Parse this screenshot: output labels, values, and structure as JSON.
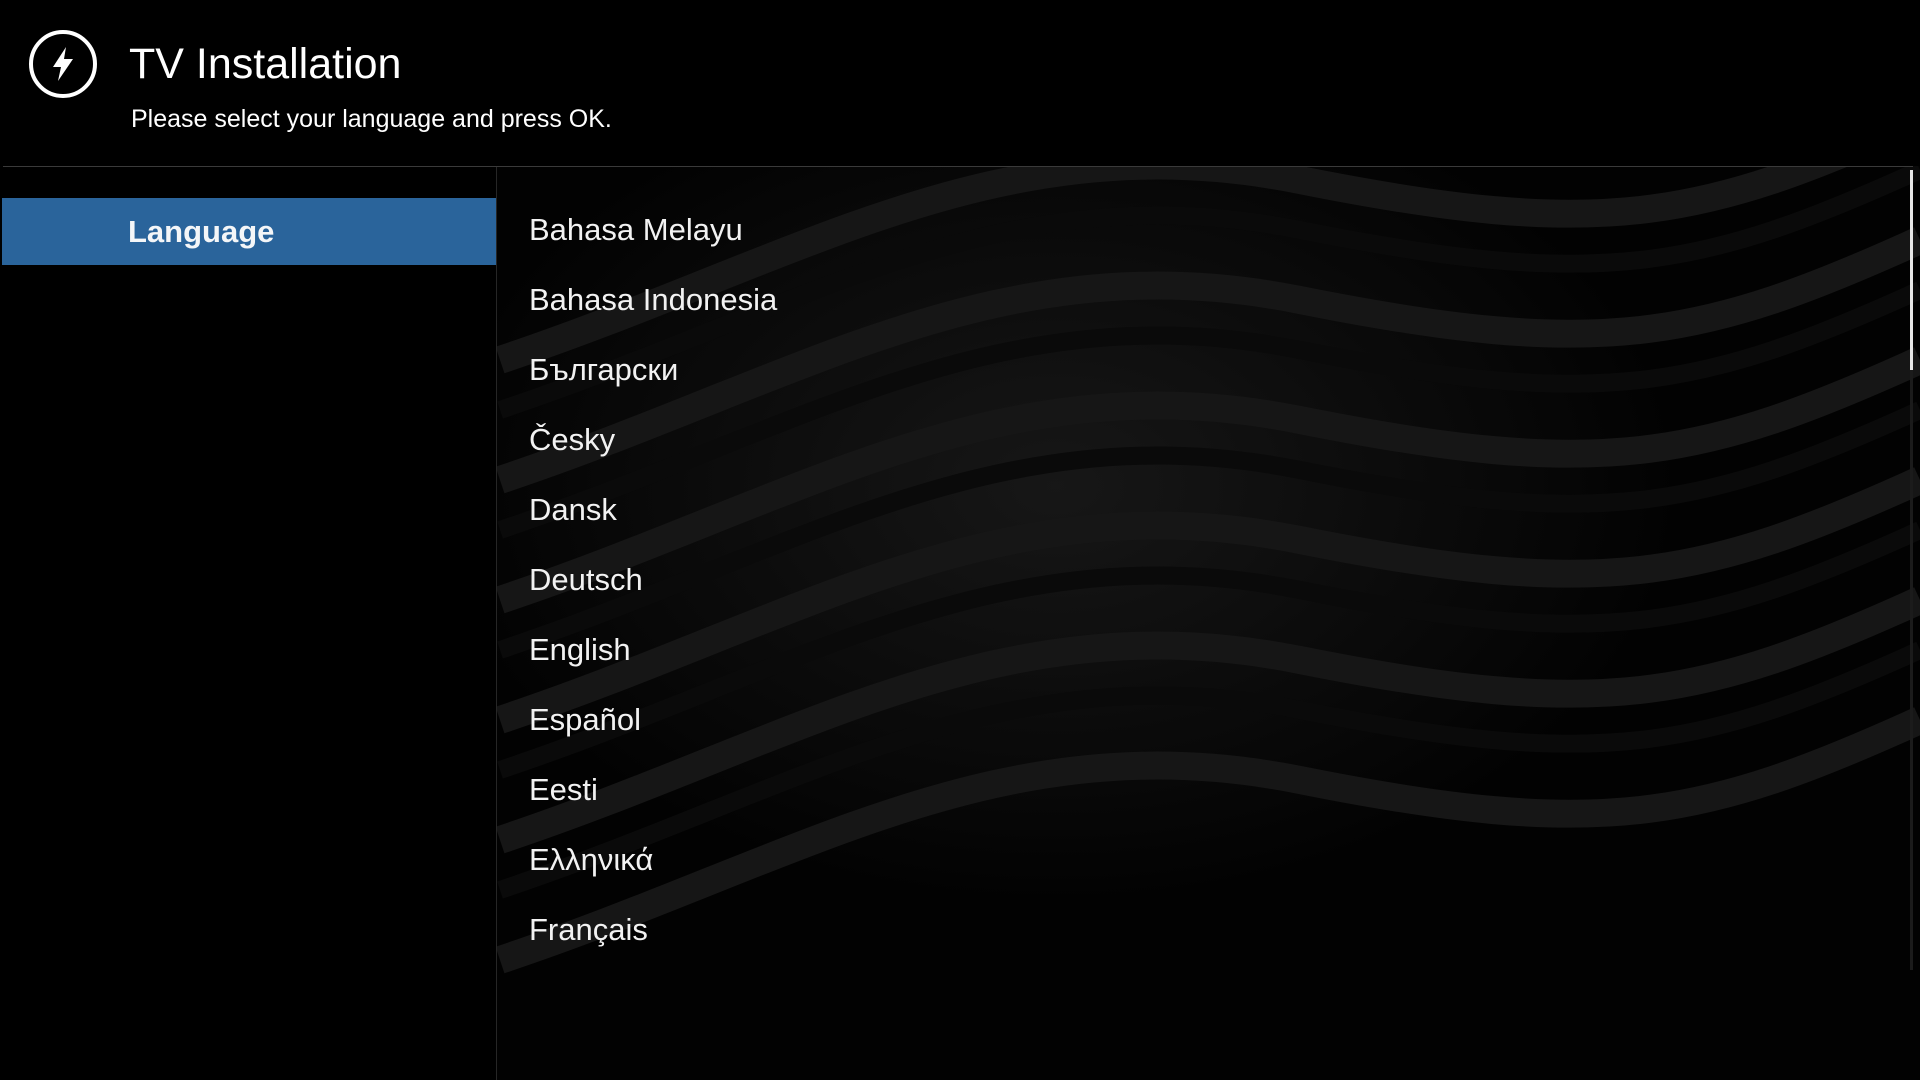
{
  "header": {
    "icon": "lightning-bolt-icon",
    "title": "TV Installation",
    "subtitle": "Please select your language and press OK."
  },
  "sidebar": {
    "items": [
      {
        "label": "Language",
        "selected": true
      }
    ],
    "selected_color": "#2a649b"
  },
  "language_list": {
    "items": [
      "Bahasa Melayu",
      "Bahasa Indonesia",
      "Български",
      "Česky",
      "Dansk",
      "Deutsch",
      "English",
      "Español",
      "Eesti",
      "Ελληνικά",
      "Français"
    ]
  },
  "scrollbar": {
    "position_fraction": 0.0,
    "visible_fraction": 0.25
  }
}
